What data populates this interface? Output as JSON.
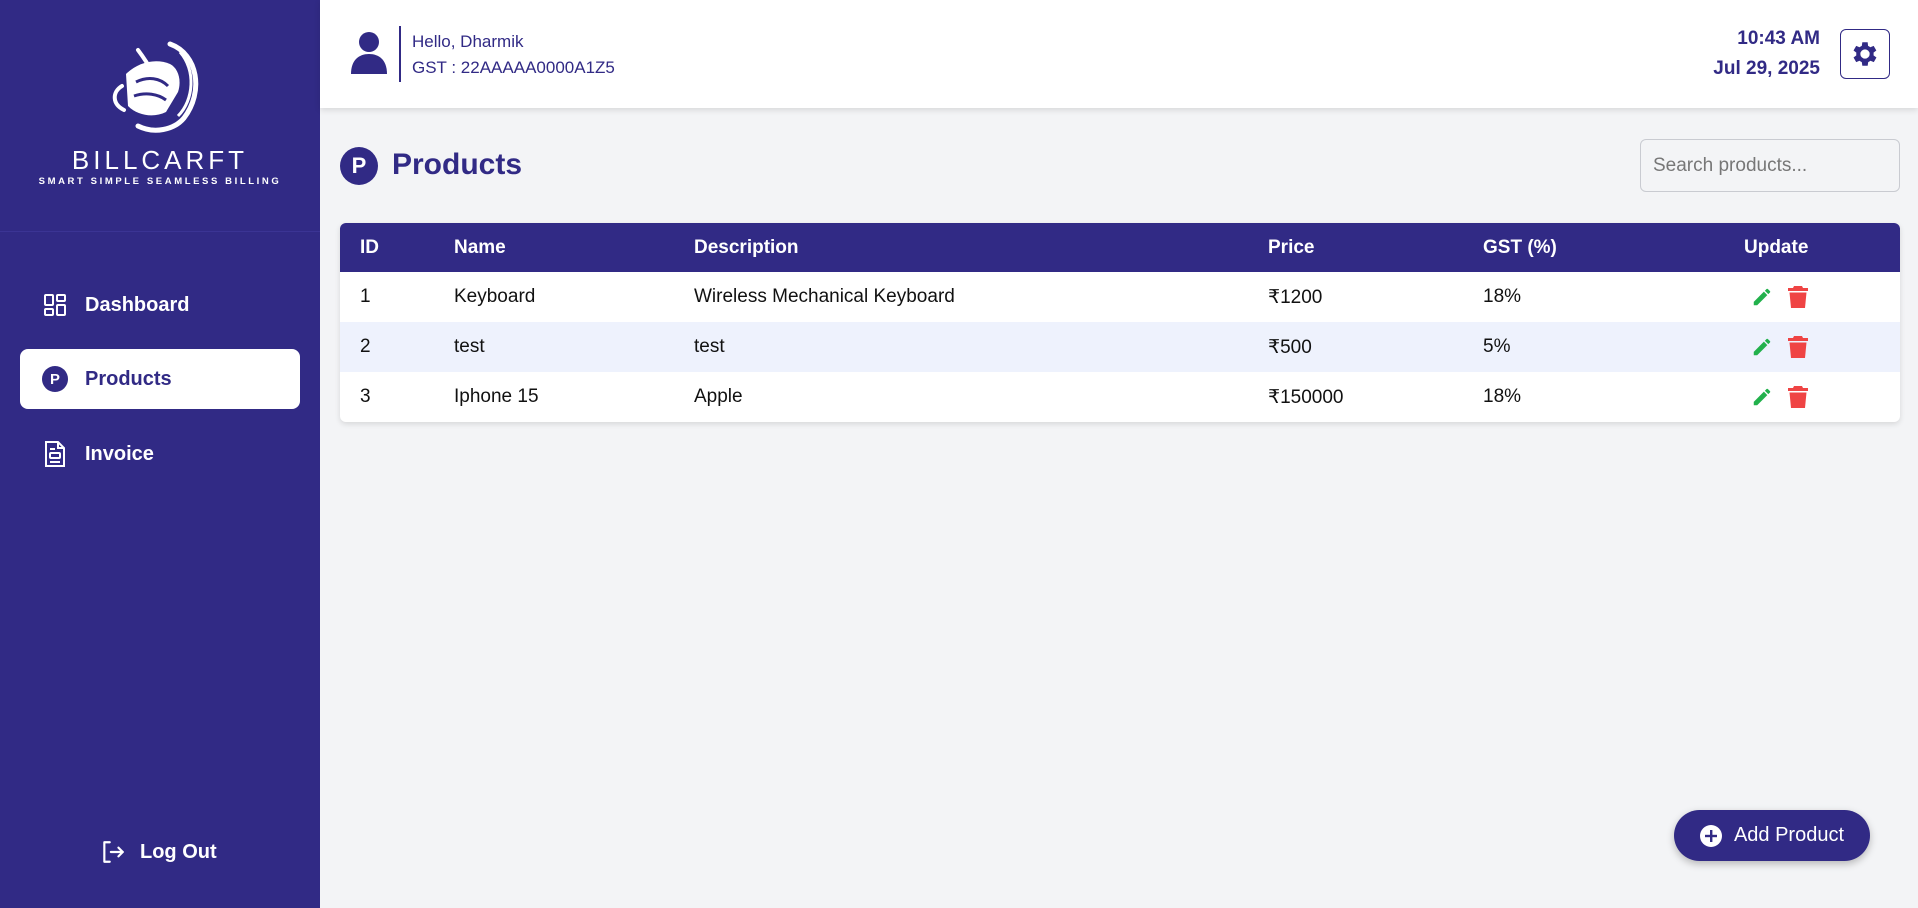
{
  "brand": {
    "name": "BILLCARFT",
    "tagline": "SMART  SIMPLE  SEAMLESS BILLING"
  },
  "sidebar": {
    "items": [
      {
        "label": "Dashboard",
        "icon": "dashboard-icon",
        "active": false
      },
      {
        "label": "Products",
        "icon": "products-p-icon",
        "active": true
      },
      {
        "label": "Invoice",
        "icon": "invoice-icon",
        "active": false
      }
    ],
    "logout_label": "Log Out"
  },
  "header": {
    "greeting": "Hello, Dharmik",
    "gst": "GST : 22AAAAA0000A1Z5",
    "time": "10:43 AM",
    "date": "Jul 29, 2025"
  },
  "page": {
    "icon_letter": "P",
    "title": "Products",
    "search_placeholder": "Search products..."
  },
  "table": {
    "columns": [
      "ID",
      "Name",
      "Description",
      "Price",
      "GST (%)",
      "Update"
    ],
    "rows": [
      {
        "id": "1",
        "name": "Keyboard",
        "description": "Wireless Mechanical Keyboard",
        "price": "₹1200",
        "gst": "18%"
      },
      {
        "id": "2",
        "name": "test",
        "description": "test",
        "price": "₹500",
        "gst": "5%"
      },
      {
        "id": "3",
        "name": "Iphone 15",
        "description": "Apple",
        "price": "₹150000",
        "gst": "18%"
      }
    ]
  },
  "add_button_label": "Add Product",
  "colors": {
    "primary": "#312a85",
    "edit": "#22b14c",
    "delete": "#ef4444",
    "row_alt": "#eef2fd"
  }
}
